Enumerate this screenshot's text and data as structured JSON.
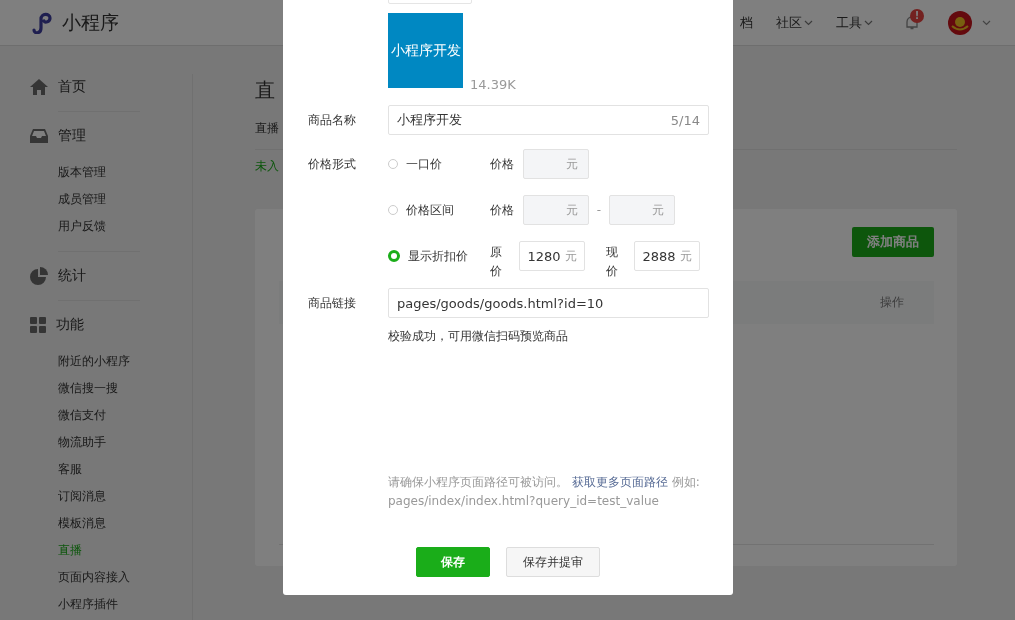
{
  "header": {
    "logo_text": "小程序",
    "nav": [
      {
        "label": "档",
        "dropdown": false
      },
      {
        "label": "社区",
        "dropdown": true
      },
      {
        "label": "工具",
        "dropdown": true
      }
    ],
    "notification_badge": "!"
  },
  "sidebar": {
    "sections": [
      {
        "label": "首页"
      },
      {
        "label": "管理",
        "items": [
          {
            "label": "版本管理",
            "selected": false
          },
          {
            "label": "成员管理",
            "selected": false
          },
          {
            "label": "用户反馈",
            "selected": false
          }
        ]
      },
      {
        "label": "统计"
      },
      {
        "label": "功能",
        "items": [
          {
            "label": "附近的小程序",
            "selected": false
          },
          {
            "label": "微信搜一搜",
            "selected": false
          },
          {
            "label": "微信支付",
            "selected": false
          },
          {
            "label": "物流助手",
            "selected": false
          },
          {
            "label": "客服",
            "selected": false
          },
          {
            "label": "订阅消息",
            "selected": false
          },
          {
            "label": "模板消息",
            "selected": false
          },
          {
            "label": "直播",
            "selected": true
          },
          {
            "label": "页面内容接入",
            "selected": false
          },
          {
            "label": "小程序插件",
            "selected": false
          }
        ]
      }
    ]
  },
  "main": {
    "title": "直",
    "subtitle": "直播",
    "status": "未入",
    "add_button": "添加商品",
    "table": {
      "columns": [
        "操作"
      ]
    }
  },
  "dialog": {
    "image": {
      "text": "小程序开发",
      "size": "14.39K"
    },
    "name": {
      "label": "商品名称",
      "value": "小程序开发",
      "counter": "5/14"
    },
    "price": {
      "label": "价格形式",
      "options": [
        {
          "kind": "single",
          "label": "一口价",
          "selected": false,
          "price_label": "价格",
          "unit": "元"
        },
        {
          "kind": "range",
          "label": "价格区间",
          "selected": false,
          "price_label": "价格",
          "unit": "元",
          "separator": "-",
          "unit_max": "元"
        },
        {
          "kind": "discount",
          "label": "显示折扣价",
          "selected": true,
          "original_label": "原价",
          "original_value": "1280",
          "original_unit": "元",
          "current_label": "现价",
          "current_value": "2888",
          "current_unit": "元"
        }
      ]
    },
    "link": {
      "label": "商品链接",
      "value": "pages/goods/goods.html?id=10",
      "success": "校验成功，可用微信扫码预览商品"
    },
    "hint": {
      "before": "请确保小程序页面路径可被访问。",
      "link": "获取更多页面路径",
      "after": "例如:",
      "example": "pages/index/index.html?query_id=test_value"
    },
    "buttons": [
      {
        "kind": "primary",
        "label": "保存"
      },
      {
        "kind": "default",
        "label": "保存并提审"
      }
    ]
  }
}
